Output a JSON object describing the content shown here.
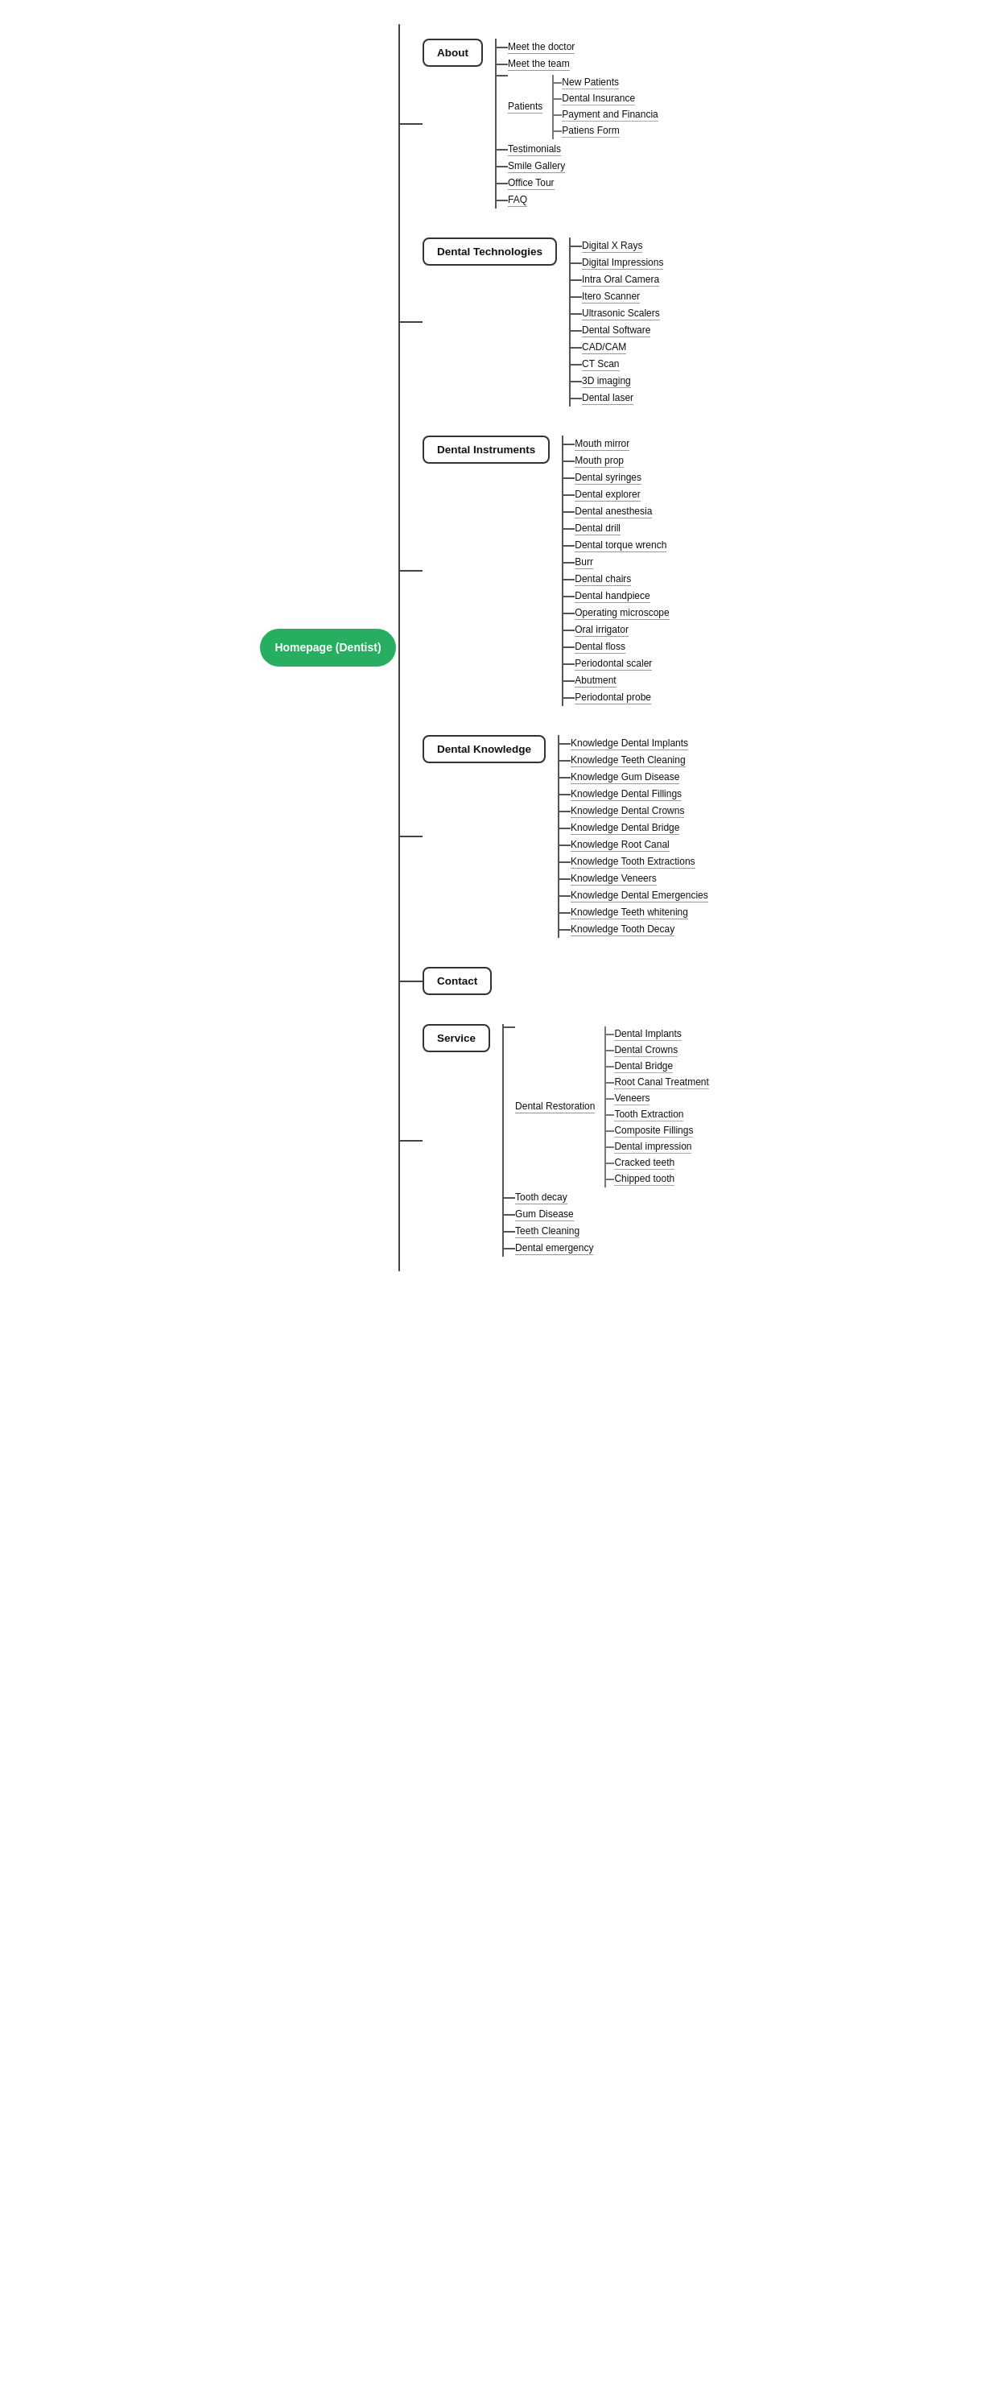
{
  "root": {
    "label": "Homepage (Dentist)"
  },
  "sections": [
    {
      "id": "about",
      "label": "About",
      "children": [
        {
          "label": "Meet the doctor"
        },
        {
          "label": "Meet the team"
        },
        {
          "label": "Patients",
          "sub": [
            "New Patients",
            "Dental Insurance",
            "Payment and Financia",
            "Patiens Form"
          ]
        },
        {
          "label": "Testimonials"
        },
        {
          "label": "Smile Gallery"
        },
        {
          "label": "Office Tour"
        },
        {
          "label": "FAQ"
        }
      ]
    },
    {
      "id": "dental-technologies",
      "label": "Dental Technologies",
      "children": [
        {
          "label": "Digital X Rays"
        },
        {
          "label": "Digital Impressions"
        },
        {
          "label": "Intra Oral Camera"
        },
        {
          "label": "Itero Scanner"
        },
        {
          "label": "Ultrasonic Scalers"
        },
        {
          "label": "Dental Software"
        },
        {
          "label": "CAD/CAM"
        },
        {
          "label": "CT Scan"
        },
        {
          "label": "3D imaging"
        },
        {
          "label": "Dental laser"
        }
      ]
    },
    {
      "id": "dental-instruments",
      "label": "Dental Instruments",
      "children": [
        {
          "label": "Mouth mirror"
        },
        {
          "label": "Mouth prop"
        },
        {
          "label": "Dental syringes"
        },
        {
          "label": "Dental explorer"
        },
        {
          "label": "Dental anesthesia"
        },
        {
          "label": "Dental drill"
        },
        {
          "label": "Dental torque wrench"
        },
        {
          "label": "Burr"
        },
        {
          "label": "Dental chairs"
        },
        {
          "label": "Dental handpiece"
        },
        {
          "label": "Operating microscope"
        },
        {
          "label": "Oral irrigator"
        },
        {
          "label": "Dental floss"
        },
        {
          "label": "Periodontal scaler"
        },
        {
          "label": "Abutment"
        },
        {
          "label": "Periodontal probe"
        }
      ]
    },
    {
      "id": "dental-knowledge",
      "label": "Dental Knowledge",
      "children": [
        {
          "label": "Knowledge Dental Implants"
        },
        {
          "label": "Knowledge Teeth Cleaning"
        },
        {
          "label": "Knowledge Gum Disease"
        },
        {
          "label": "Knowledge Dental Fillings"
        },
        {
          "label": "Knowledge Dental Crowns"
        },
        {
          "label": "Knowledge Dental Bridge"
        },
        {
          "label": "Knowledge Root Canal"
        },
        {
          "label": "Knowledge Tooth Extractions"
        },
        {
          "label": "Knowledge Veneers"
        },
        {
          "label": "Knowledge Dental Emergencies"
        },
        {
          "label": "Knowledge Teeth whitening"
        },
        {
          "label": "Knowledge Tooth Decay"
        }
      ]
    },
    {
      "id": "contact",
      "label": "Contact",
      "children": []
    },
    {
      "id": "service",
      "label": "Service",
      "children": [
        {
          "label": "Dental Restoration",
          "sub": [
            "Dental Implants",
            "Dental Crowns",
            "Dental Bridge",
            "Root Canal Treatment",
            "Veneers",
            "Tooth Extraction",
            "Composite Fillings",
            "Dental impression",
            "Cracked teeth",
            "Chipped tooth"
          ]
        },
        {
          "label": "Tooth decay"
        },
        {
          "label": "Gum Disease"
        },
        {
          "label": "Teeth Cleaning"
        },
        {
          "label": "Dental emergency"
        }
      ]
    }
  ]
}
